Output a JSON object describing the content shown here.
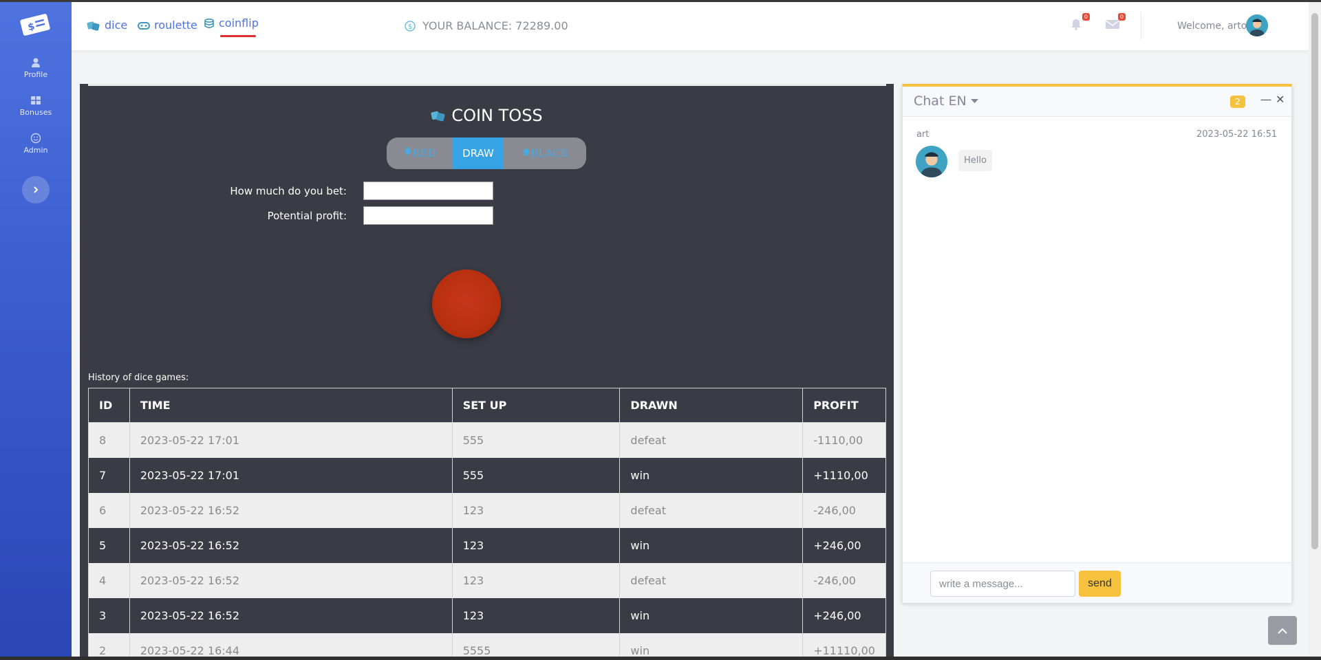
{
  "sidebar": {
    "items": [
      {
        "label": "Profile",
        "icon": "user-icon"
      },
      {
        "label": "Bonuses",
        "icon": "grid-icon"
      },
      {
        "label": "Admin",
        "icon": "smile-icon"
      }
    ],
    "toggle_icon": "chevron-right-icon"
  },
  "topbar": {
    "nav": [
      {
        "label": "dice",
        "icon": "dice-icon"
      },
      {
        "label": "roulette",
        "icon": "gamepad-icon"
      },
      {
        "label": "coinflip",
        "icon": "coins-icon",
        "active": true
      }
    ],
    "balance": "YOUR BALANCE: 72289.00",
    "alerts_count": "0",
    "messages_count": "0",
    "welcome": "Welcome, arto"
  },
  "game": {
    "title": "COIN TOSS",
    "options": {
      "red": "RED",
      "draw": "DRAW",
      "black": "BLACK"
    },
    "bet_label": "How much do you bet:",
    "profit_label": "Potential profit:",
    "bet_value": "",
    "profit_value": "",
    "history_caption": "History of dice games:",
    "columns": [
      "ID",
      "TIME",
      "SET UP",
      "DRAWN",
      "PROFIT"
    ],
    "rows": [
      [
        "8",
        "2023-05-22 17:01",
        "555",
        "defeat",
        "-1110,00"
      ],
      [
        "7",
        "2023-05-22 17:01",
        "555",
        "win",
        "+1110,00"
      ],
      [
        "6",
        "2023-05-22 16:52",
        "123",
        "defeat",
        "-246,00"
      ],
      [
        "5",
        "2023-05-22 16:52",
        "123",
        "win",
        "+246,00"
      ],
      [
        "4",
        "2023-05-22 16:52",
        "123",
        "defeat",
        "-246,00"
      ],
      [
        "3",
        "2023-05-22 16:52",
        "123",
        "win",
        "+246,00"
      ],
      [
        "2",
        "2023-05-22 16:44",
        "5555",
        "win",
        "+11110,00"
      ]
    ]
  },
  "chat": {
    "title": "Chat EN",
    "count": "2",
    "messages": [
      {
        "author": "art",
        "time": "2023-05-22 16:51",
        "text": "Hello"
      }
    ],
    "input_placeholder": "write a message...",
    "send_label": "send"
  },
  "colors": {
    "sidebar": "#4e73df",
    "accent_yellow": "#f6c23e",
    "game_bg": "#3a3b45",
    "draw_blue": "#36a3e5",
    "coin_red": "#b8300f"
  }
}
